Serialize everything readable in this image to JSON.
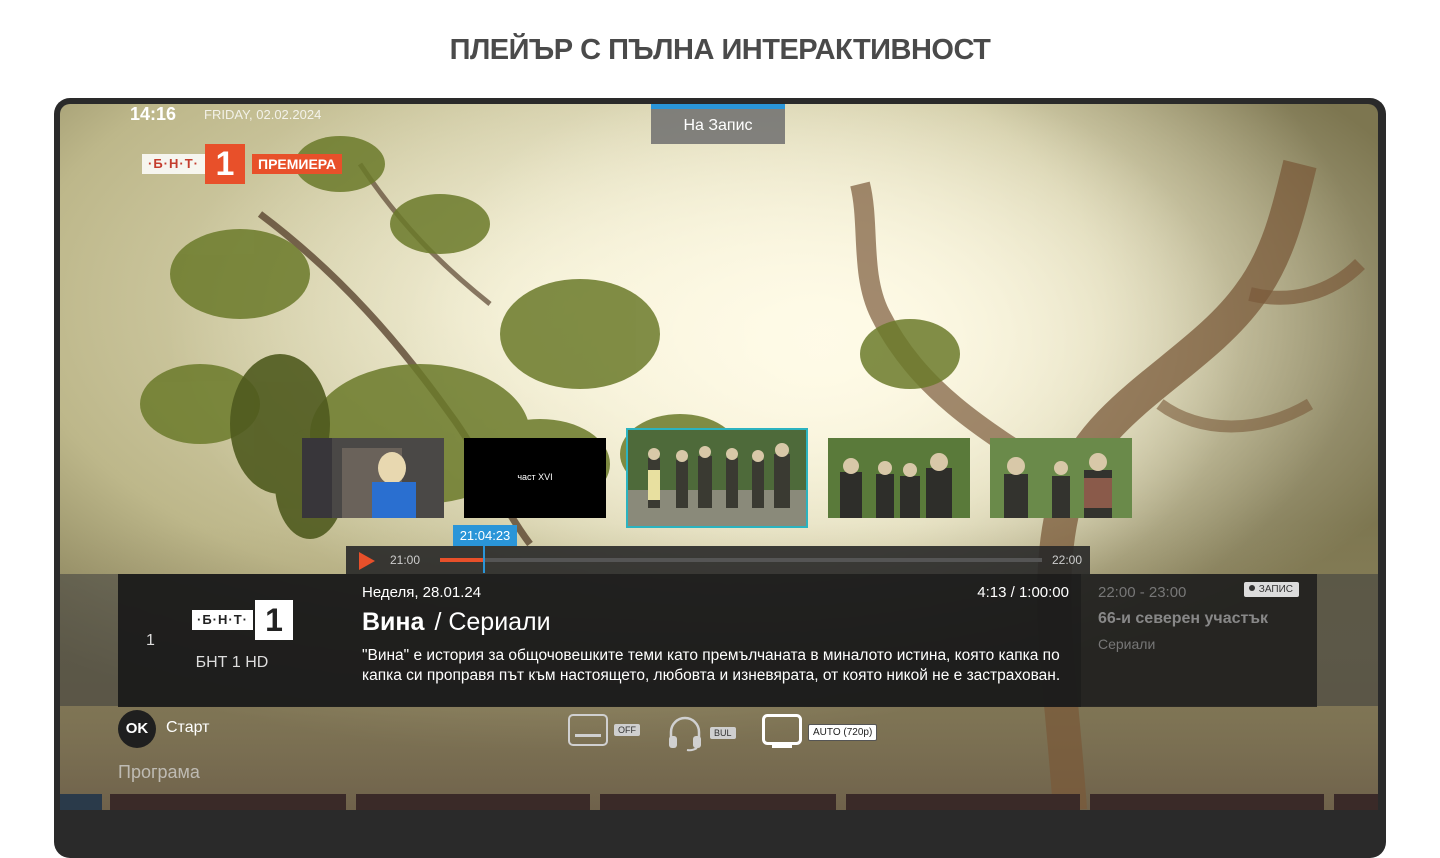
{
  "page": {
    "title": "ПЛЕЙЪР С ПЪЛНА ИНТЕРАКТИВНОСТ"
  },
  "status": {
    "clock": "14:16",
    "date": "FRIDAY, 02.02.2024"
  },
  "record_tab": {
    "label": "На Запис"
  },
  "broadcast_logo": {
    "bnt": "·Б·Н·Т·",
    "number": "1",
    "tag": "ПРЕМИЕРА"
  },
  "thumbnails": [
    {
      "label": ""
    },
    {
      "label": "част XVI"
    },
    {
      "label": ""
    },
    {
      "label": ""
    },
    {
      "label": ""
    }
  ],
  "seek": {
    "start": "21:00",
    "end": "22:00",
    "current": "21:04:23",
    "progress": 0.073
  },
  "channel": {
    "number": "1",
    "logo_text": "·Б·Н·Т·",
    "logo_number": "1",
    "name": "БНТ 1 HD"
  },
  "program": {
    "date": "Неделя, 28.01.24",
    "time": "4:13 / 1:00:00",
    "title": "Вина",
    "genre": "/ Сериали",
    "description": "\"Вина\" е история за общочовешките теми като премълчаната в миналото истина, която капка по капка си проправя път към настоящето, любовта и изневярата, от която никой не е застрахован."
  },
  "next": {
    "time": "22:00 - 23:00",
    "badge": "ЗАПИС",
    "title": "66-и северен участък",
    "genre": "Сериали"
  },
  "controls": {
    "ok_key": "OK",
    "ok_label": "Старт",
    "subtitles_chip": "OFF",
    "audio_chip": "BUL",
    "quality_chip": "AUTO (720p)"
  },
  "section": {
    "program_label": "Програма"
  },
  "colors": {
    "accent": "#e8502a",
    "highlight": "#2a95d8",
    "selection": "#2bb3c0"
  }
}
